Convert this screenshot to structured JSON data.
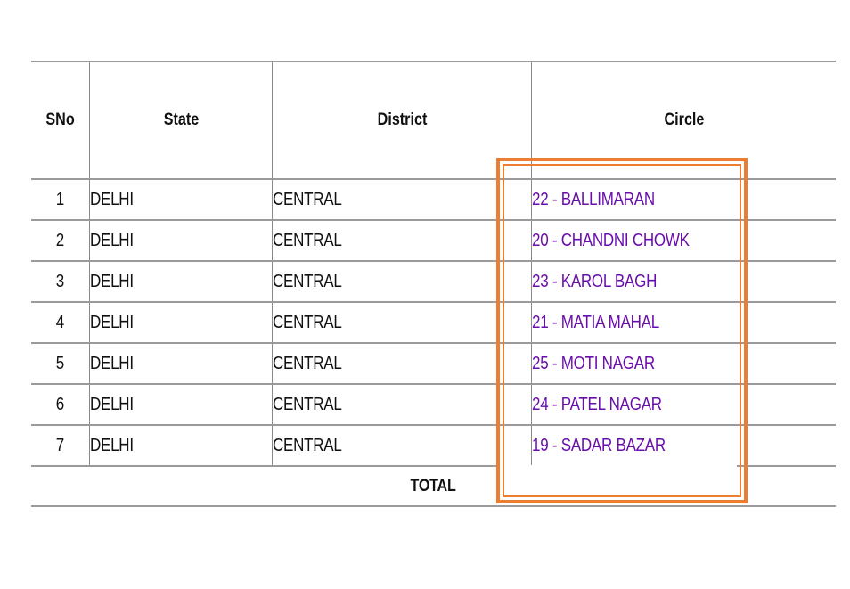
{
  "table": {
    "headers": {
      "sno": "SNo",
      "state": "State",
      "district": "District",
      "circle": "Circle"
    },
    "rows": [
      {
        "sno": "1",
        "state": "DELHI",
        "district": "CENTRAL",
        "circle": "22 - BALLIMARAN"
      },
      {
        "sno": "2",
        "state": "DELHI",
        "district": "CENTRAL",
        "circle": "20 - CHANDNI CHOWK"
      },
      {
        "sno": "3",
        "state": "DELHI",
        "district": "CENTRAL",
        "circle": "23 - KAROL BAGH"
      },
      {
        "sno": "4",
        "state": "DELHI",
        "district": "CENTRAL",
        "circle": "21 - MATIA MAHAL"
      },
      {
        "sno": "5",
        "state": "DELHI",
        "district": "CENTRAL",
        "circle": "25 - MOTI NAGAR"
      },
      {
        "sno": "6",
        "state": "DELHI",
        "district": "CENTRAL",
        "circle": "24 - PATEL NAGAR"
      },
      {
        "sno": "7",
        "state": "DELHI",
        "district": "CENTRAL",
        "circle": "19 - SADAR BAZAR"
      }
    ],
    "total_label": "TOTAL"
  },
  "highlight": {
    "color": "#ed7d31",
    "target": "Circle column"
  },
  "colors": {
    "link": "#6a0dad",
    "grid": "#9a9a9a"
  }
}
